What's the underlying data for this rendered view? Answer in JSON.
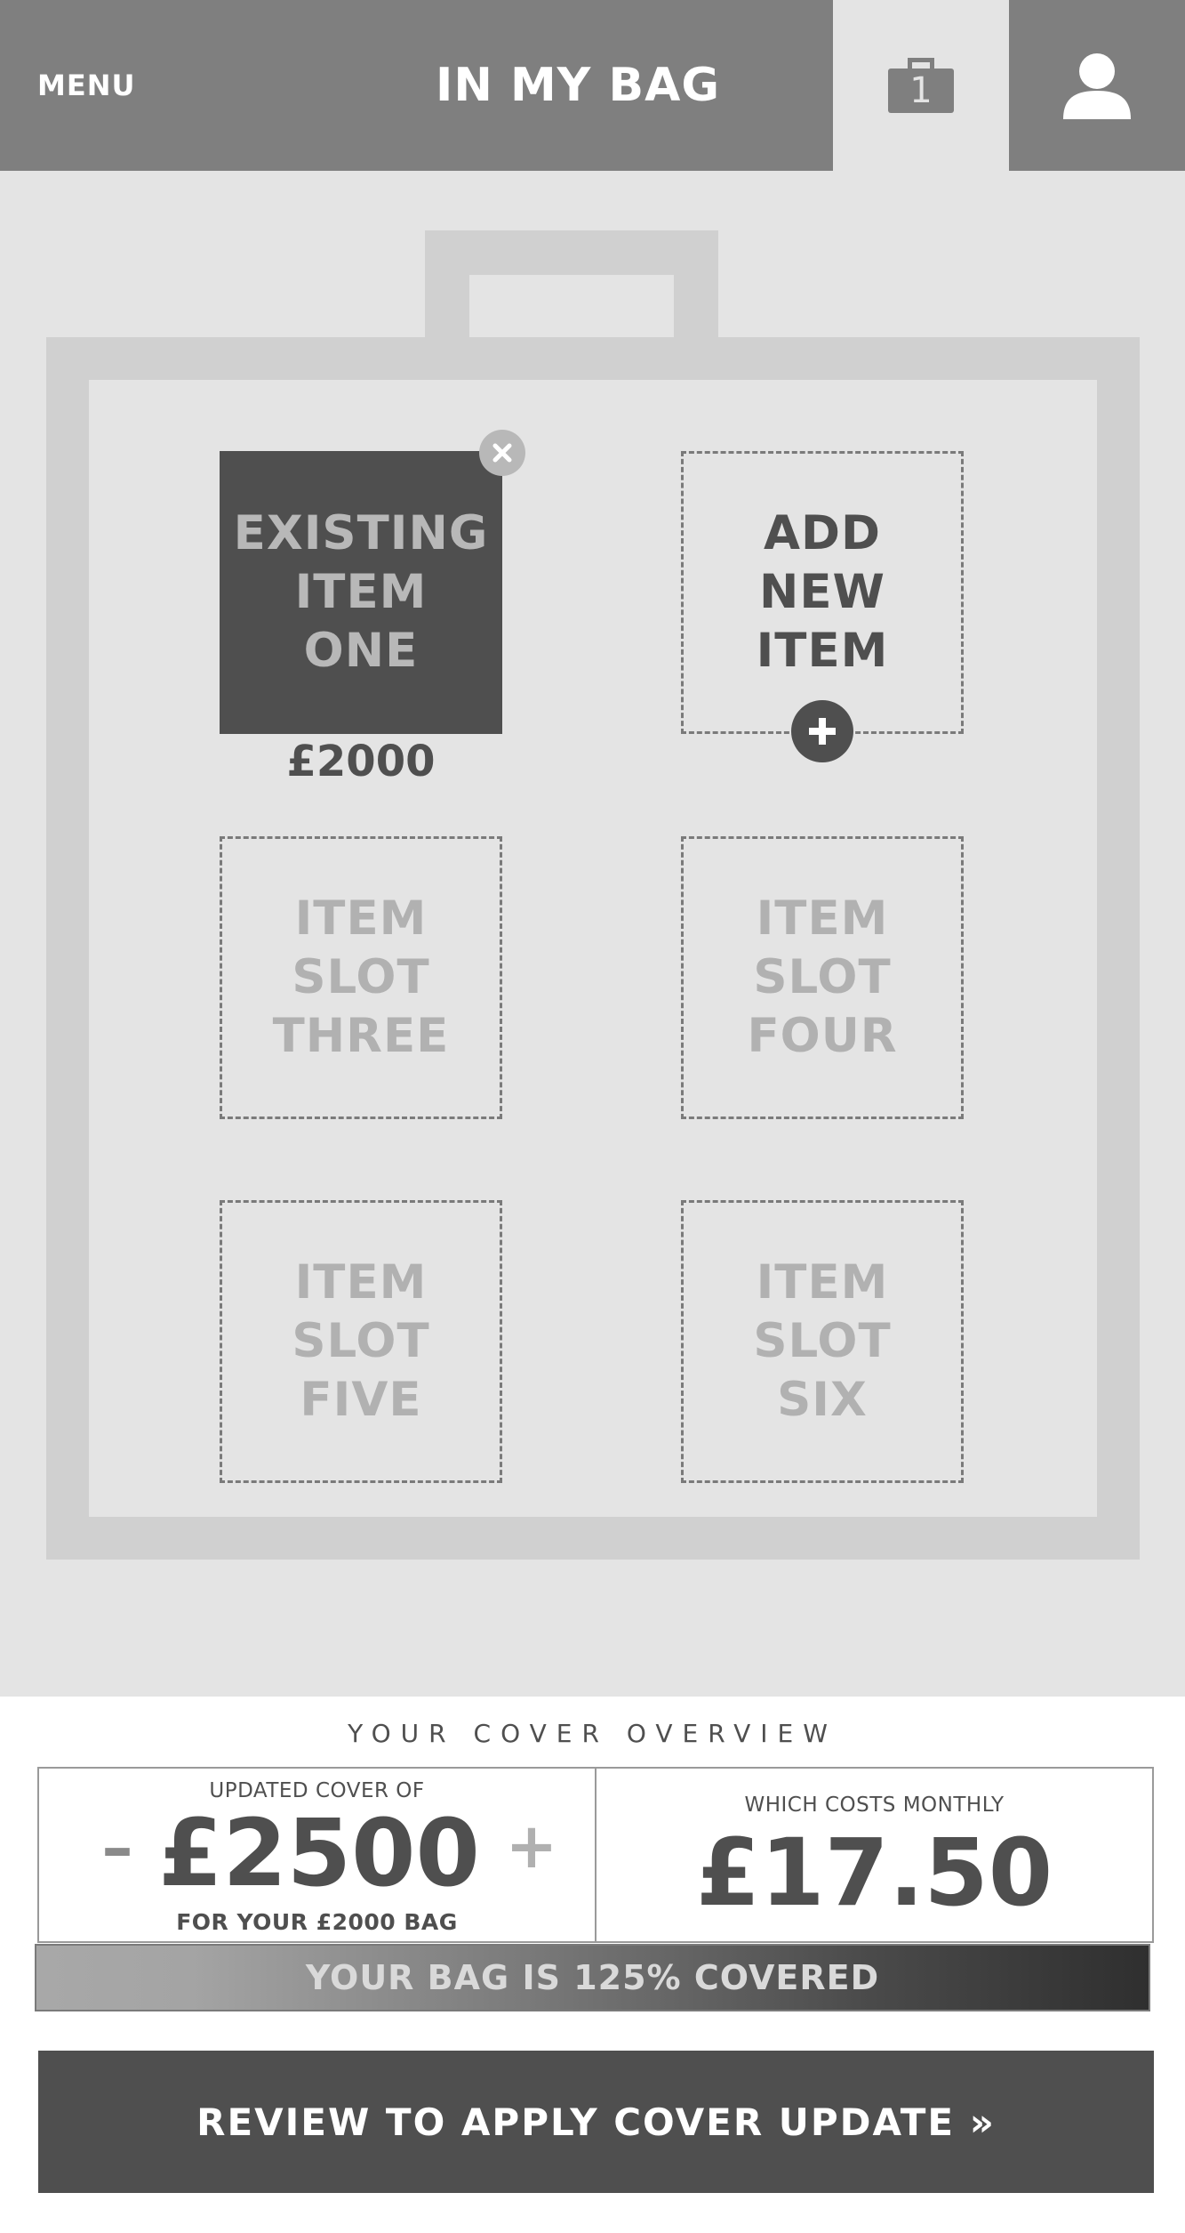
{
  "header": {
    "menu_label": "MENU",
    "title": "IN MY BAG",
    "bag_count": "1"
  },
  "bag": {
    "slots": [
      {
        "label": "EXISTING\nITEM\nONE",
        "price": "£2000",
        "state": "filled"
      },
      {
        "label": "ADD\nNEW\nITEM",
        "state": "add"
      },
      {
        "label": "ITEM\nSLOT\nTHREE",
        "state": "empty"
      },
      {
        "label": "ITEM\nSLOT\nFOUR",
        "state": "empty"
      },
      {
        "label": "ITEM\nSLOT\nFIVE",
        "state": "empty"
      },
      {
        "label": "ITEM\nSLOT\nSIX",
        "state": "empty"
      }
    ]
  },
  "overview": {
    "title": "YOUR COVER OVERVIEW",
    "cover_label": "UPDATED COVER OF",
    "cover_amount": "£2500",
    "minus": "–",
    "plus": "+",
    "cover_sub": "FOR YOUR £2000 BAG",
    "cost_label": "WHICH COSTS MONTHLY",
    "cost_amount": "£17.50",
    "coverage_text": "YOUR BAG IS 125% COVERED",
    "coverage_percent": 125
  },
  "cta": {
    "label": "REVIEW TO APPLY COVER UPDATE »"
  },
  "icons": {
    "bag": "bag-icon",
    "user": "user-icon",
    "remove": "close-icon",
    "add": "plus-icon"
  },
  "colors": {
    "header_bg": "#7f7f7f",
    "dark": "#4f4f4f",
    "page_bg": "#e4e4e4",
    "bag_frame": "#d0d0d0"
  }
}
